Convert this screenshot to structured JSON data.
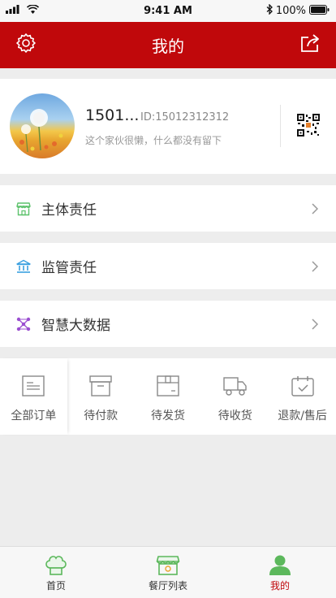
{
  "status_bar": {
    "time": "9:41 AM",
    "battery": "100%"
  },
  "header": {
    "title": "我的"
  },
  "profile": {
    "name": "1501...",
    "id_text": "ID:15012312312",
    "signature": "这个家伙很懒，什么都没有留下"
  },
  "menu": [
    {
      "label": "主体责任",
      "icon": "store-icon",
      "color": "#5cc26b"
    },
    {
      "label": "监管责任",
      "icon": "government-building-icon",
      "color": "#3aa0e0"
    },
    {
      "label": "智慧大数据",
      "icon": "data-network-icon",
      "color": "#9b4fd0"
    }
  ],
  "orders": [
    {
      "label": "全部订单",
      "icon": "order-list-icon"
    },
    {
      "label": "待付款",
      "icon": "wallet-box-icon"
    },
    {
      "label": "待发货",
      "icon": "package-icon"
    },
    {
      "label": "待收货",
      "icon": "delivery-truck-icon"
    },
    {
      "label": "退款/售后",
      "icon": "refund-calendar-icon"
    }
  ],
  "tabbar": [
    {
      "label": "首页",
      "icon": "chef-hat-icon",
      "active": false
    },
    {
      "label": "餐厅列表",
      "icon": "restaurant-icon",
      "active": false
    },
    {
      "label": "我的",
      "icon": "user-icon",
      "active": true
    }
  ],
  "colors": {
    "brand": "#c0080b",
    "tab_green": "#5cb85c",
    "background": "#ededed"
  }
}
